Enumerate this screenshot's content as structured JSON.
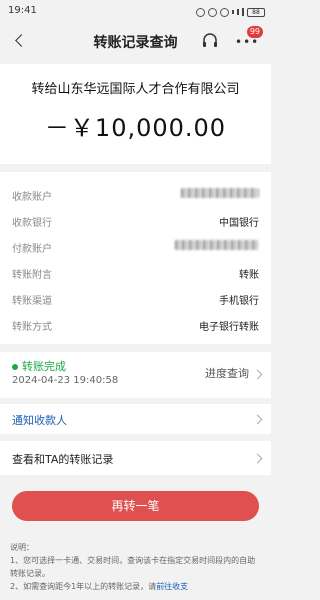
{
  "status_bar": {
    "time": "19:41",
    "battery": "88"
  },
  "nav": {
    "title": "转账记录查询",
    "badge": "99"
  },
  "hero": {
    "payee_title": "转给山东华远国际人才合作有限公司",
    "amount": "－￥10,000.00"
  },
  "details": [
    {
      "label": "收款账户",
      "value": ""
    },
    {
      "label": "收款银行",
      "value": "中国银行"
    },
    {
      "label": "付款账户",
      "value": ""
    },
    {
      "label": "转账附言",
      "value": "转账"
    },
    {
      "label": "转账渠道",
      "value": "手机银行"
    },
    {
      "label": "转账方式",
      "value": "电子银行转账"
    }
  ],
  "status": {
    "text": "转账完成",
    "time": "2024-04-23 19:40:58",
    "progress_link": "进度查询",
    "color": "#1aaa44"
  },
  "notify": {
    "label": "通知收款人"
  },
  "history": {
    "label": "查看和TA的转账记录"
  },
  "action": {
    "again_label": "再转一笔",
    "color": "#e0504f"
  },
  "notes": {
    "heading": "说明：",
    "line1": "1、您可选择一卡通、交易时间，查询该卡在指定交易时间段内的自助转账记录。",
    "line2_prefix": "2、如需查询距今1年以上的转账记录，请",
    "line2_link": "前往收支"
  }
}
